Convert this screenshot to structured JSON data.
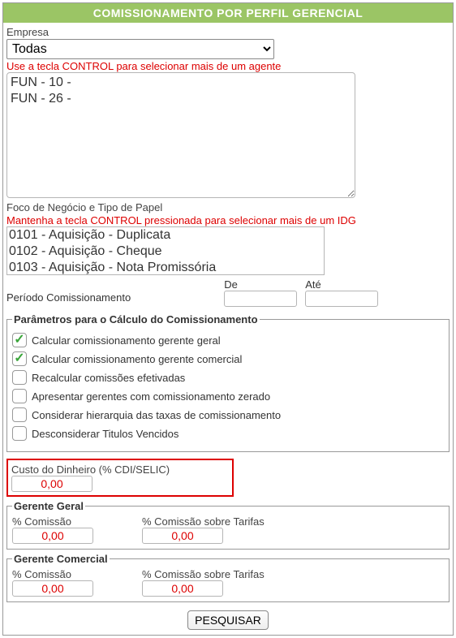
{
  "header": {
    "title": "COMISSIONAMENTO POR PERFIL GERENCIAL"
  },
  "empresa": {
    "label": "Empresa",
    "selected": "Todas"
  },
  "agentes": {
    "hint": "Use a tecla CONTROL para selecionar mais de um agente",
    "options": [
      "FUN - 10 -",
      "FUN - 26 -"
    ]
  },
  "foco": {
    "label": "Foco de Negócio e Tipo de Papel",
    "hint": "Mantenha a tecla CONTROL pressionada para selecionar mais de um IDG",
    "options": [
      "0101 - Aquisição - Duplicata",
      "0102 - Aquisição - Cheque",
      "0103 - Aquisição - Nota Promissória"
    ]
  },
  "periodo": {
    "label": "Período Comissionamento",
    "de_label": "De",
    "ate_label": "Até",
    "de_value": "",
    "ate_value": ""
  },
  "parametros": {
    "legend": "Parâmetros para o Cálculo do Comissionamento",
    "items": [
      {
        "label": "Calcular comissionamento gerente geral",
        "checked": true
      },
      {
        "label": "Calcular comissionamento gerente comercial",
        "checked": true
      },
      {
        "label": "Recalcular comissões efetivadas",
        "checked": false
      },
      {
        "label": "Apresentar gerentes com comissionamento zerado",
        "checked": false
      },
      {
        "label": "Considerar hierarquia das taxas de comissionamento",
        "checked": false
      },
      {
        "label": "Desconsiderar Titulos Vencidos",
        "checked": false
      }
    ]
  },
  "custo": {
    "label": "Custo do Dinheiro (% CDI/SELIC)",
    "value": "0,00"
  },
  "gerente_geral": {
    "legend": "Gerente Geral",
    "comissao_label": "% Comissão",
    "comissao_value": "0,00",
    "tarifas_label": "% Comissão sobre Tarifas",
    "tarifas_value": "0,00"
  },
  "gerente_comercial": {
    "legend": "Gerente Comercial",
    "comissao_label": "% Comissão",
    "comissao_value": "0,00",
    "tarifas_label": "% Comissão sobre Tarifas",
    "tarifas_value": "0,00"
  },
  "actions": {
    "pesquisar": "PESQUISAR"
  }
}
